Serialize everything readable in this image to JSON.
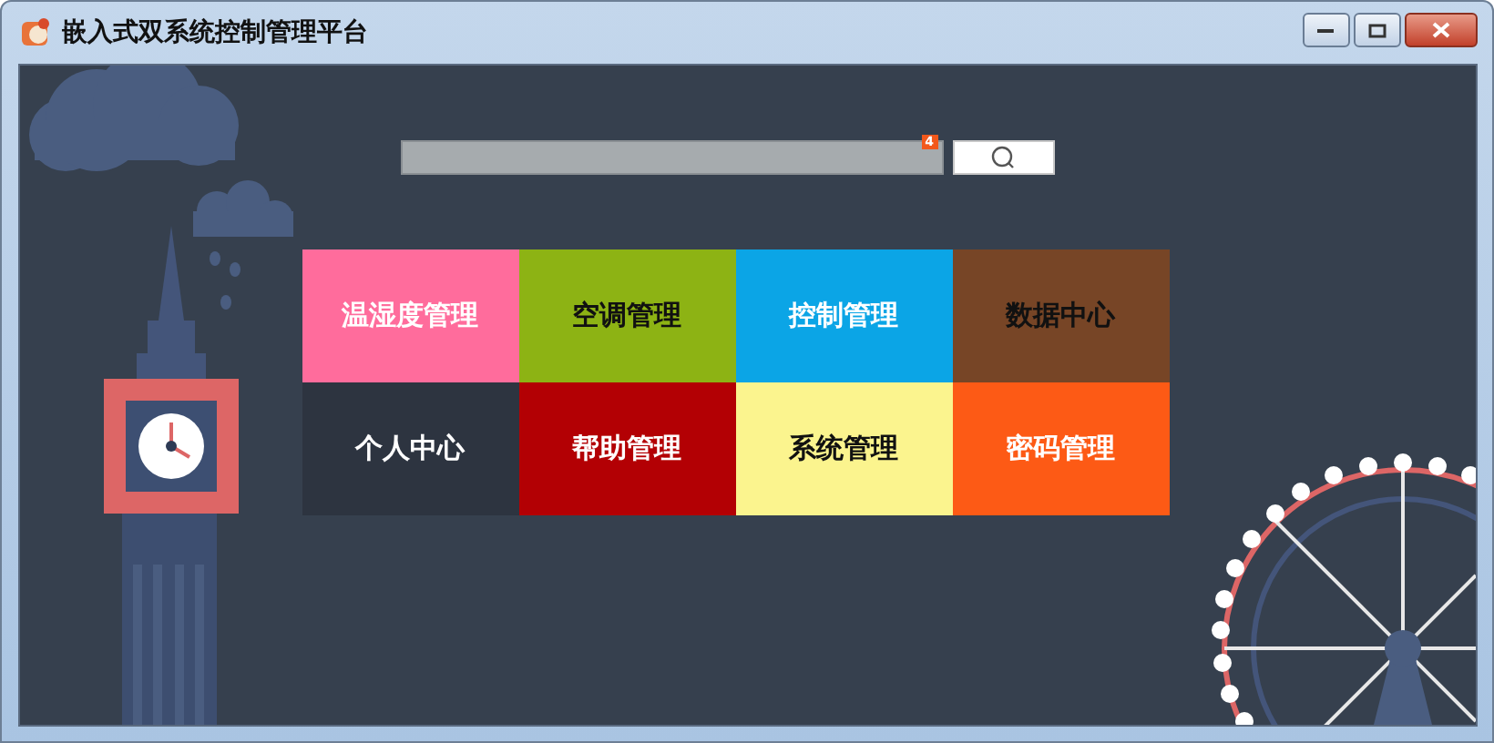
{
  "window": {
    "title": "嵌入式双系统控制管理平台"
  },
  "search": {
    "badge": "4"
  },
  "tiles": [
    {
      "label": "温湿度管理",
      "color": "#ff6c9c",
      "dark_label": false
    },
    {
      "label": "空调管理",
      "color": "#8db314",
      "dark_label": true
    },
    {
      "label": "控制管理",
      "color": "#0ba5e6",
      "dark_label": false
    },
    {
      "label": "数据中心",
      "color": "#774526",
      "dark_label": true
    },
    {
      "label": "个人中心",
      "color": "#2d3440",
      "dark_label": false
    },
    {
      "label": "帮助管理",
      "color": "#b30004",
      "dark_label": false
    },
    {
      "label": "系统管理",
      "color": "#fbf48e",
      "dark_label": true
    },
    {
      "label": "密码管理",
      "color": "#fd5a15",
      "dark_label": false
    }
  ]
}
